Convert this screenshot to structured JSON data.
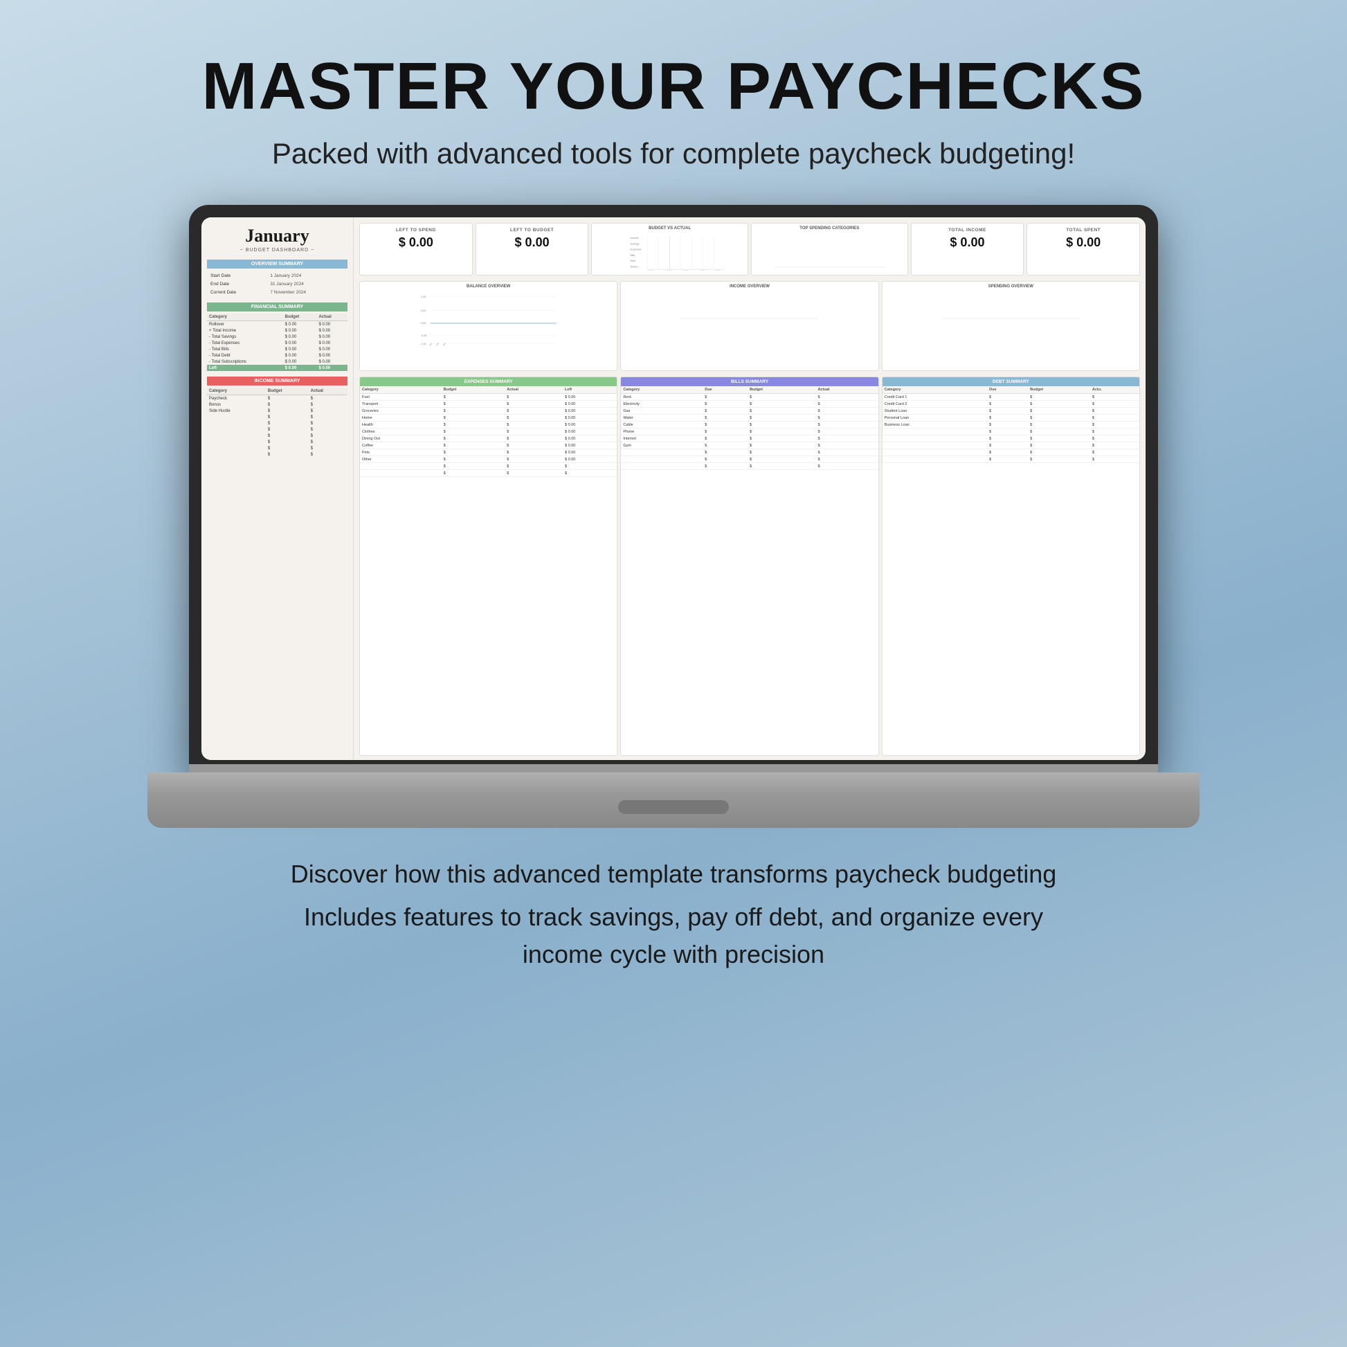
{
  "hero": {
    "title": "MASTER YOUR PAYCHECKS",
    "subtitle": "Packed with advanced tools for complete paycheck budgeting!",
    "bottom_text_1": "Discover how this advanced template transforms paycheck budgeting",
    "bottom_text_2": "Includes features to track savings, pay off debt, and organize every\nincome cycle with precision"
  },
  "dashboard": {
    "month": "January",
    "month_label": "~ BUDGET DASHBOARD ~",
    "overview_summary_title": "OVERVIEW SUMMARY",
    "overview_rows": [
      {
        "label": "Start Date",
        "value": "1 January 2024"
      },
      {
        "label": "End Date",
        "value": "31 January 2024"
      },
      {
        "label": "Current Date",
        "value": "7 November 2024"
      }
    ],
    "financial_summary_title": "FINANCIAL SUMMARY",
    "fin_headers": [
      "Category",
      "Budget",
      "Actual"
    ],
    "fin_rows": [
      {
        "cat": "Rollover",
        "budget": "$ 0.00",
        "actual": "$ 0.00"
      },
      {
        "cat": "+ Total Income",
        "budget": "$ 0.00",
        "actual": "$ 0.00"
      },
      {
        "cat": "- Total Savings",
        "budget": "$ 0.00",
        "actual": "$ 0.00"
      },
      {
        "cat": "- Total Expenses",
        "budget": "$ 0.00",
        "actual": "$ 0.00"
      },
      {
        "cat": "- Total Bills",
        "budget": "$ 0.00",
        "actual": "$ 0.00"
      },
      {
        "cat": "- Total Debt",
        "budget": "$ 0.00",
        "actual": "$ 0.00"
      },
      {
        "cat": "- Total Subscriptions",
        "budget": "$ 0.00",
        "actual": "$ 0.00"
      }
    ],
    "fin_left": {
      "cat": "Left",
      "budget": "$ 0.00",
      "actual": "$ 0.00"
    },
    "income_summary_title": "INCOME SUMMARY",
    "income_headers": [
      "Category",
      "Budget",
      "Actual"
    ],
    "income_rows": [
      {
        "cat": "Paycheck",
        "budget": "$",
        "actual": "$"
      },
      {
        "cat": "Bonus",
        "budget": "$",
        "actual": "$"
      },
      {
        "cat": "Side Hustle",
        "budget": "$",
        "actual": "$"
      },
      {
        "cat": "",
        "budget": "$",
        "actual": "$"
      },
      {
        "cat": "",
        "budget": "$",
        "actual": "$"
      },
      {
        "cat": "",
        "budget": "$",
        "actual": "$"
      },
      {
        "cat": "",
        "budget": "$",
        "actual": "$"
      },
      {
        "cat": "",
        "budget": "$",
        "actual": "$"
      },
      {
        "cat": "",
        "budget": "$",
        "actual": "$"
      },
      {
        "cat": "",
        "budget": "$",
        "actual": "$"
      }
    ],
    "metrics": {
      "left_to_spend_label": "LEFT TO SPEND",
      "left_to_spend_value": "$ 0.00",
      "left_to_budget_label": "LEFT TO BUDGET",
      "left_to_budget_value": "$ 0.00",
      "total_income_label": "TOTAL INCOME",
      "total_income_value": "$ 0.00",
      "total_spent_label": "TOTAL SPENT",
      "total_spent_value": "$ 0.00"
    },
    "charts": {
      "budget_vs_actual_title": "BUDGET VS ACTUAL",
      "budget_vs_actual_categories": [
        "Income",
        "Savings",
        "Expenses",
        "Bills",
        "Debt",
        "Subscr..."
      ],
      "balance_overview_title": "BALANCE OVERVIEW",
      "income_overview_title": "INCOME OVERVIEW",
      "spending_overview_title": "SPENDING OVERVIEW",
      "top_spending_title": "TOP SPENDING CATEGORIES"
    },
    "expenses_summary_title": "EXPENSES SUMMARY",
    "exp_headers": [
      "Category",
      "Budget",
      "Actual",
      "Left"
    ],
    "exp_rows": [
      {
        "cat": "Fuel",
        "budget": "$",
        "actual": "$",
        "left": "$ 0.00"
      },
      {
        "cat": "Transport",
        "budget": "$",
        "actual": "$",
        "left": "$ 0.00"
      },
      {
        "cat": "Groceries",
        "budget": "$",
        "actual": "$",
        "left": "$ 0.00"
      },
      {
        "cat": "Home",
        "budget": "$",
        "actual": "$",
        "left": "$ 0.00"
      },
      {
        "cat": "Health",
        "budget": "$",
        "actual": "$",
        "left": "$ 0.00"
      },
      {
        "cat": "Clothes",
        "budget": "$",
        "actual": "$",
        "left": "$ 0.00"
      },
      {
        "cat": "Dining Out",
        "budget": "$",
        "actual": "$",
        "left": "$ 0.00"
      },
      {
        "cat": "Coffee",
        "budget": "$",
        "actual": "$",
        "left": "$ 0.00"
      },
      {
        "cat": "Pets",
        "budget": "$",
        "actual": "$",
        "left": "$ 0.00"
      },
      {
        "cat": "Other",
        "budget": "$",
        "actual": "$",
        "left": "$ 0.00"
      },
      {
        "cat": "",
        "budget": "$",
        "actual": "$",
        "left": "$"
      },
      {
        "cat": "",
        "budget": "$",
        "actual": "$",
        "left": "$"
      }
    ],
    "bills_summary_title": "BILLS SUMMARY",
    "bills_headers": [
      "Category",
      "Due",
      "Budget",
      "Actual"
    ],
    "bills_rows": [
      {
        "cat": "Rent",
        "due": "$",
        "budget": "$",
        "actual": "$"
      },
      {
        "cat": "Electricity",
        "due": "$",
        "budget": "$",
        "actual": "$"
      },
      {
        "cat": "Gas",
        "due": "$",
        "budget": "$",
        "actual": "$"
      },
      {
        "cat": "Water",
        "due": "$",
        "budget": "$",
        "actual": "$"
      },
      {
        "cat": "Cable",
        "due": "$",
        "budget": "$",
        "actual": "$"
      },
      {
        "cat": "Phone",
        "due": "$",
        "budget": "$",
        "actual": "$"
      },
      {
        "cat": "Internet",
        "due": "$",
        "budget": "$",
        "actual": "$"
      },
      {
        "cat": "Gym",
        "due": "$",
        "budget": "$",
        "actual": "$"
      },
      {
        "cat": "",
        "due": "$",
        "budget": "$",
        "actual": "$"
      },
      {
        "cat": "",
        "due": "$",
        "budget": "$",
        "actual": "$"
      },
      {
        "cat": "",
        "due": "$",
        "budget": "$",
        "actual": "$"
      }
    ],
    "debt_summary_title": "DEBT SUMMARY",
    "debt_headers": [
      "Category",
      "Due",
      "Budget",
      "Actual"
    ],
    "debt_rows": [
      {
        "cat": "Credit Card 1",
        "due": "$",
        "budget": "$",
        "actual": "$"
      },
      {
        "cat": "Credit Card 2",
        "due": "$",
        "budget": "$",
        "actual": "$"
      },
      {
        "cat": "Student Loan",
        "due": "$",
        "budget": "$",
        "actual": "$"
      },
      {
        "cat": "Personal Loan",
        "due": "$",
        "budget": "$",
        "actual": "$"
      },
      {
        "cat": "Business Loan",
        "due": "$",
        "budget": "$",
        "actual": "$"
      },
      {
        "cat": "",
        "due": "$",
        "budget": "$",
        "actual": "$"
      },
      {
        "cat": "",
        "due": "$",
        "budget": "$",
        "actual": "$"
      },
      {
        "cat": "",
        "due": "$",
        "budget": "$",
        "actual": "$"
      },
      {
        "cat": "",
        "due": "$",
        "budget": "$",
        "actual": "$"
      },
      {
        "cat": "",
        "due": "$",
        "budget": "$",
        "actual": "$"
      }
    ]
  }
}
